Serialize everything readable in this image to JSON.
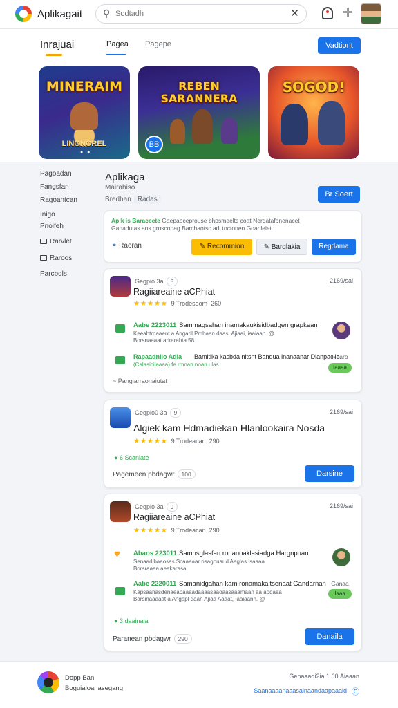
{
  "topbar": {
    "brand": "Aplikagait",
    "search_placeholder": "Sodtadh",
    "icons": [
      "logo-icon",
      "search-icon",
      "close-icon",
      "notification-icon",
      "plus-icon",
      "avatar"
    ]
  },
  "header": {
    "page_title": "Inrajuai",
    "tabs": [
      "Pagea",
      "Pagepe"
    ],
    "action_label": "Vadtiont"
  },
  "hero": {
    "cards": [
      {
        "title": "MINERAIM",
        "subtitle": "LINONOREL"
      },
      {
        "title": "REBEN SARANNERA",
        "badge": "BB"
      },
      {
        "title": "SOGOD!"
      }
    ]
  },
  "sidebar": {
    "items": [
      "Pagoadan",
      "Fangsfan",
      "Ragoantcan",
      "Inigo",
      "Pnoifeh",
      "Rarvlet",
      "Raroos",
      "Parcbdls"
    ]
  },
  "app": {
    "title": "Aplikaga",
    "developer": "Mairahiso",
    "meta_label": "Bredhan",
    "meta_chip": "Radas",
    "button": "Br Soert"
  },
  "notice": {
    "highlight": "Aplk is Baracecte",
    "line1": "Gaepaoceprouse bhpsmeelts coat Nerdatafonenacet",
    "line2": "Ganadutas ans grosconag Barchaotsc adi toctonen Goanleiet.",
    "link_label": "Raoran",
    "btn_yellow": "Recommion",
    "btn_grey": "Barglakia",
    "btn_blue": "Regdama"
  },
  "cards": [
    {
      "meta": "Gegpio 3a",
      "count": "8",
      "date": "2169/sai",
      "title": "Ragiiareaine aCPhiat",
      "rating_text": "9 Trodesoom",
      "rating_num": "260",
      "reviews": [
        {
          "tag": "Aabe 2223011",
          "text": "Sammagsahan inamakaukisidbadgen grapkean",
          "sub": "Keeabtrnaaent a Angadl Pmbaan daas, Ajiaai, iaaiaan. @",
          "sub2": "Borsnaaaat arkarahta 58"
        },
        {
          "tag": "Rapaadnilo Adia",
          "text": "Bamitika kasbda nitsnt Bandua inanaanar Dianpacile.",
          "sub": "",
          "sub2": "(Calasicilaaaa) fe rmnan noan ulas",
          "status": "Rearo",
          "pill": "Iaaaa"
        }
      ],
      "footer": "Pangiarraonaiutat"
    },
    {
      "meta": "Gegpio0 3a",
      "count": "9",
      "date": "2169/sai",
      "title": "Algiek kam Hdmadiekan Hlanlookaira Nosda",
      "rating_text": "9 Trodeacan",
      "rating_num": "290",
      "green_label": "6 Scanlate",
      "footer_label": "Pagemeen pbdagwr",
      "footer_count": "100",
      "button": "Darsine"
    },
    {
      "meta": "Gegpio 3a",
      "count": "9",
      "date": "2169/sai",
      "title": "Ragiiareaine aCPhiat",
      "rating_text": "9 Trodeacan",
      "rating_num": "290",
      "reviews": [
        {
          "tag": "Abaos 223011",
          "text": "Samnsglasfan ronanoaklasiadga Hargnpuan",
          "sub": "Senaadibaaosas Scaaaaar nsagpuaud Aaglas lsaaaa",
          "sub2": "Borsraaaa aeakarasa"
        },
        {
          "tag": "Aabe 2220011",
          "text": "Samanidgahan kam ronamakaitsenaat Gandarnan",
          "sub": "Kapsaanasdenaeapaaaadaaaasaaoaasaaamaan aa apdaaa",
          "sub2": "Barsinaaaaat a Angapl daan Ajiaa Aaaat, Iaaiaann. @",
          "status": "Ganaa",
          "pill": "Iaaa"
        }
      ],
      "green_label": "3 daainala",
      "footer_label": "Paranean pbdagwr",
      "footer_count": "290",
      "button": "Danaila"
    }
  ],
  "footer": {
    "line1": "Dopp Ban",
    "line2": "Boguialoanasegang",
    "right_text": "Genaaadi2ia 1 60.Aiaaan",
    "right_link": "Saanaaaanaaasainaandaapaaaid"
  },
  "colors": {
    "primary": "#1a73e8",
    "accent_yellow": "#fbbc04",
    "success": "#34a853"
  }
}
